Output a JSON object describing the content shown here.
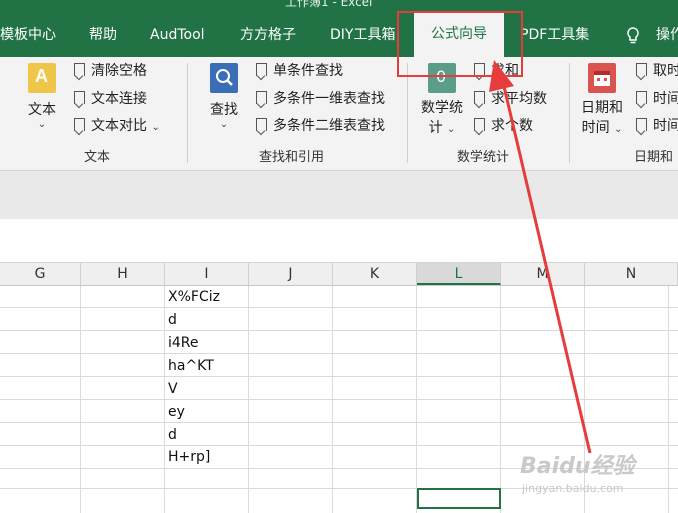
{
  "window": {
    "title_partial": "工作簿1 - Excel"
  },
  "tabs": [
    {
      "label": "模板中心"
    },
    {
      "label": "帮助"
    },
    {
      "label": "AudTool"
    },
    {
      "label": "方方格子"
    },
    {
      "label": "DIY工具箱"
    },
    {
      "label": "公式向导",
      "active": true
    },
    {
      "label": "PDF工具集"
    },
    {
      "label": "操作"
    }
  ],
  "ribbon": {
    "text_group": {
      "big_button": "文本",
      "items": [
        "清除空格",
        "文本连接",
        "文本对比"
      ],
      "label": "文本"
    },
    "lookup_group": {
      "big_button": "查找",
      "items": [
        "单条件查找",
        "多条件一维表查找",
        "多条件二维表查找"
      ],
      "label": "查找和引用"
    },
    "math_group": {
      "big_button_line1": "数学统",
      "big_button_line2": "计",
      "items": [
        "求和",
        "求平均数",
        "求个数"
      ],
      "label": "数学统计"
    },
    "date_group": {
      "big_button_line1": "日期和",
      "big_button_line2": "时间",
      "items": [
        "取时",
        "时间",
        "时间"
      ],
      "label": "日期和"
    }
  },
  "sheet": {
    "columns": [
      "G",
      "H",
      "I",
      "J",
      "K",
      "L",
      "M",
      "N"
    ],
    "selected_column": "L",
    "cells_I": [
      "X%FCiz",
      "d",
      "i4Re",
      "ha^KT",
      "V",
      "ey",
      "d",
      "H+rp]"
    ]
  },
  "watermark": {
    "main": "Baidu经验",
    "sub": "jingyan.baidu.com"
  },
  "colors": {
    "excel_green": "#217346",
    "annotation_red": "#e63c3c"
  }
}
